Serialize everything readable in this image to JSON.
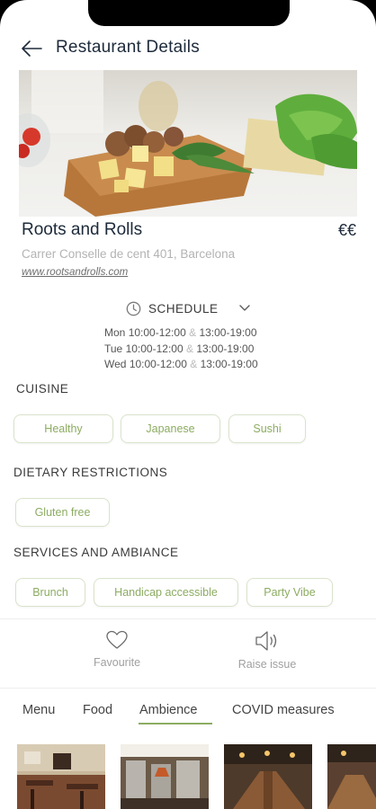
{
  "header": {
    "title": "Restaurant Details"
  },
  "restaurant": {
    "name": "Roots and Rolls",
    "price": "€€",
    "address": "Carrer Conselle de cent 401, Barcelona",
    "website": "www.rootsandrolls.com"
  },
  "schedule": {
    "label": "SCHEDULE",
    "rows": [
      {
        "day": "Mon",
        "slot1": "10:00-12:00",
        "sep": "&",
        "slot2": "13:00-19:00"
      },
      {
        "day": "Tue",
        "slot1": "10:00-12:00",
        "sep": "&",
        "slot2": "13:00-19:00"
      },
      {
        "day": "Wed",
        "slot1": "10:00-12:00",
        "sep": "&",
        "slot2": "13:00-19:00"
      }
    ]
  },
  "cuisine": {
    "title": "CUISINE",
    "chips": [
      "Healthy",
      "Japanese",
      "Sushi"
    ]
  },
  "dietary": {
    "title": "DIETARY RESTRICTIONS",
    "chips": [
      "Gluten free"
    ]
  },
  "services": {
    "title": "SERVICES AND AMBIANCE",
    "chips": [
      "Brunch",
      "Handicap accessible",
      "Party Vibe"
    ]
  },
  "actions": {
    "favourite": "Favourite",
    "raise_issue": "Raise issue"
  },
  "tabs": [
    {
      "label": "Menu",
      "active": false
    },
    {
      "label": "Food",
      "active": false
    },
    {
      "label": "Ambience",
      "active": true
    },
    {
      "label": "COVID measures",
      "active": false
    }
  ],
  "colors": {
    "accent": "#8cac62",
    "chip_border": "#d9e3cb",
    "text": "#1d2a3a",
    "muted": "#b3b3b3"
  },
  "icons": [
    "back-arrow-icon",
    "clock-icon",
    "chevron-down-icon",
    "heart-icon",
    "speaker-icon"
  ]
}
